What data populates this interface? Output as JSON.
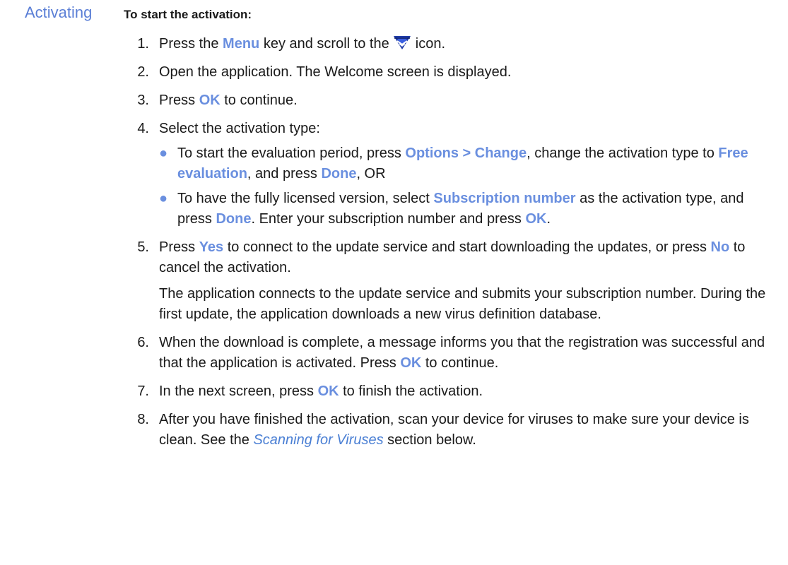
{
  "heading": "Activating",
  "intro": "To start the activation:",
  "steps": {
    "s1": {
      "num": "1.",
      "a": "Press the ",
      "k1": "Menu",
      "b": " key and scroll to the ",
      "c": " icon.",
      "icon": "app-shield-icon"
    },
    "s2": {
      "num": "2.",
      "text": "Open the application. The Welcome screen is displayed."
    },
    "s3": {
      "num": "3.",
      "a": "Press ",
      "k1": "OK",
      "b": " to continue."
    },
    "s4": {
      "num": "4.",
      "text": "Select the activation type:",
      "bullets": {
        "b1": {
          "a": "To start the evaluation period, press ",
          "k1": "Options > Change",
          "b": ", change the activation type to ",
          "k2": "Free evaluation",
          "c": ", and press ",
          "k3": "Done",
          "d": ", OR"
        },
        "b2": {
          "a": "To have the fully licensed version, select ",
          "k1": "Subscription number",
          "b": " as the activation type, and press ",
          "k2": "Done",
          "c": ". Enter your subscription number and press ",
          "k3": "OK",
          "d": "."
        }
      }
    },
    "s5": {
      "num": "5.",
      "a": "Press ",
      "k1": "Yes",
      "b": " to connect to the update service and start downloading the updates, or press ",
      "k2": "No",
      "c": " to cancel the activation.",
      "para": "The application connects to the update service and submits your subscription number. During the first update, the application downloads a new virus definition database."
    },
    "s6": {
      "num": "6.",
      "a": "When the download is complete, a message informs you that the registration was successful and that the application is activated. Press ",
      "k1": "OK",
      "b": " to continue."
    },
    "s7": {
      "num": "7.",
      "a": "In the next screen, press ",
      "k1": "OK",
      "b": " to finish the activation."
    },
    "s8": {
      "num": "8.",
      "a": "After you have finished the activation, scan your device for viruses to make sure your device is clean. See the ",
      "link": "Scanning for Viruses",
      "b": " section below."
    }
  },
  "colors": {
    "heading": "#5b7fd6",
    "keyword": "#6a8fdf",
    "link": "#4a7fd4",
    "text": "#1a1a1a"
  }
}
